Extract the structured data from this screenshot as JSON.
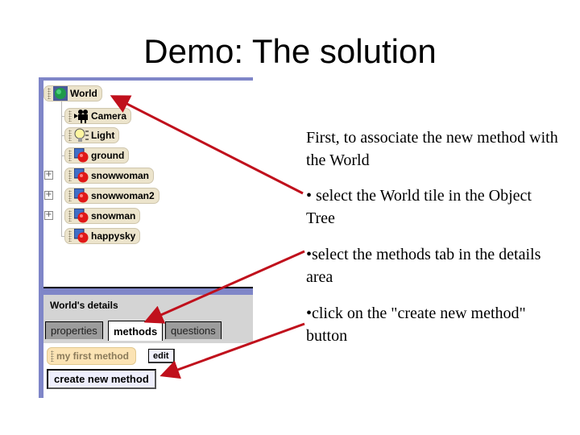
{
  "slide": {
    "title": "Demo:  The solution"
  },
  "object_tree": {
    "items": [
      {
        "label": "World",
        "icon": "globe-icon",
        "expandable": false
      },
      {
        "label": "Camera",
        "icon": "camera-icon",
        "expandable": false
      },
      {
        "label": "Light",
        "icon": "lightbulb-icon",
        "expandable": false
      },
      {
        "label": "ground",
        "icon": "object-icon",
        "expandable": false
      },
      {
        "label": "snowwoman",
        "icon": "object-icon",
        "expandable": true
      },
      {
        "label": "snowwoman2",
        "icon": "object-icon",
        "expandable": true
      },
      {
        "label": "snowman",
        "icon": "object-icon",
        "expandable": true
      },
      {
        "label": "happysky",
        "icon": "object-icon",
        "expandable": false
      }
    ]
  },
  "details": {
    "title": "World's details",
    "tabs": [
      {
        "label": "properties",
        "active": false
      },
      {
        "label": "methods",
        "active": true
      },
      {
        "label": "questions",
        "active": false
      }
    ],
    "method_tile": "my first method",
    "edit_label": "edit",
    "create_label": "create new method"
  },
  "instructions": {
    "intro": "First, to associate the new method with the World",
    "steps": [
      "• select the World tile in the Object Tree",
      "•select the methods tab in the details area",
      "•click on the  \"create new method\" button"
    ]
  },
  "colors": {
    "panel_frame": "#7f86c8",
    "arrow": "#c0101c",
    "tile": "#ece4cc",
    "method_tile": "#fbe3b4"
  }
}
